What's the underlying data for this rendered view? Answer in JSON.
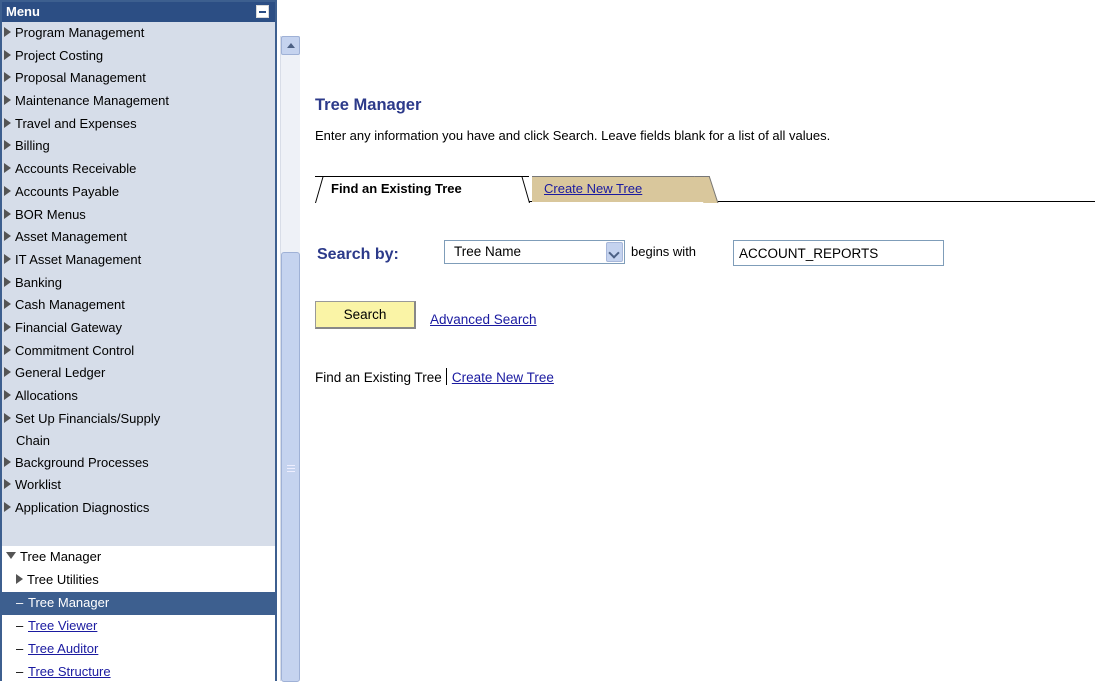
{
  "menu": {
    "title": "Menu",
    "items": [
      {
        "label": "Program Management"
      },
      {
        "label": "Project Costing"
      },
      {
        "label": "Proposal Management"
      },
      {
        "label": "Maintenance Management"
      },
      {
        "label": "Travel and Expenses"
      },
      {
        "label": "Billing"
      },
      {
        "label": "Accounts Receivable"
      },
      {
        "label": "Accounts Payable"
      },
      {
        "label": "BOR Menus"
      },
      {
        "label": "Asset Management"
      },
      {
        "label": "IT Asset Management"
      },
      {
        "label": "Banking"
      },
      {
        "label": "Cash Management"
      },
      {
        "label": "Financial Gateway"
      },
      {
        "label": "Commitment Control"
      },
      {
        "label": "General Ledger"
      },
      {
        "label": "Allocations"
      },
      {
        "label": "Set Up Financials/Supply",
        "label2": "Chain"
      },
      {
        "label": "Background Processes"
      },
      {
        "label": "Worklist"
      },
      {
        "label": "Application Diagnostics"
      }
    ],
    "open_section": {
      "label": "Tree Manager",
      "children": [
        {
          "label": "Tree Utilities",
          "type": "folder"
        },
        {
          "label": "Tree Manager",
          "type": "selected"
        },
        {
          "label": "Tree Viewer",
          "type": "link"
        },
        {
          "label": "Tree Auditor",
          "type": "link"
        },
        {
          "label": "Tree Structure",
          "type": "link"
        }
      ]
    }
  },
  "page": {
    "title": "Tree Manager",
    "instructions": "Enter any information you have and click Search. Leave fields blank for a list of all values.",
    "tabs": [
      {
        "label": "Find an Existing Tree",
        "active": true
      },
      {
        "label": "Create New Tree",
        "active": false
      }
    ],
    "search": {
      "label": "Search by:",
      "field": "Tree Name",
      "operator": "begins with",
      "value": "ACCOUNT_REPORTS",
      "button": "Search",
      "advanced_link": "Advanced Search"
    },
    "bottom_links": {
      "current": "Find an Existing Tree",
      "link": "Create New Tree"
    }
  },
  "colors": {
    "menu_header": "#2c4e84",
    "menu_background": "#d6dde9",
    "selected_item": "#3d5f8f",
    "title_text": "#2c3a8a",
    "inactive_tab": "#d9c79c",
    "search_button": "#faf4a6"
  }
}
